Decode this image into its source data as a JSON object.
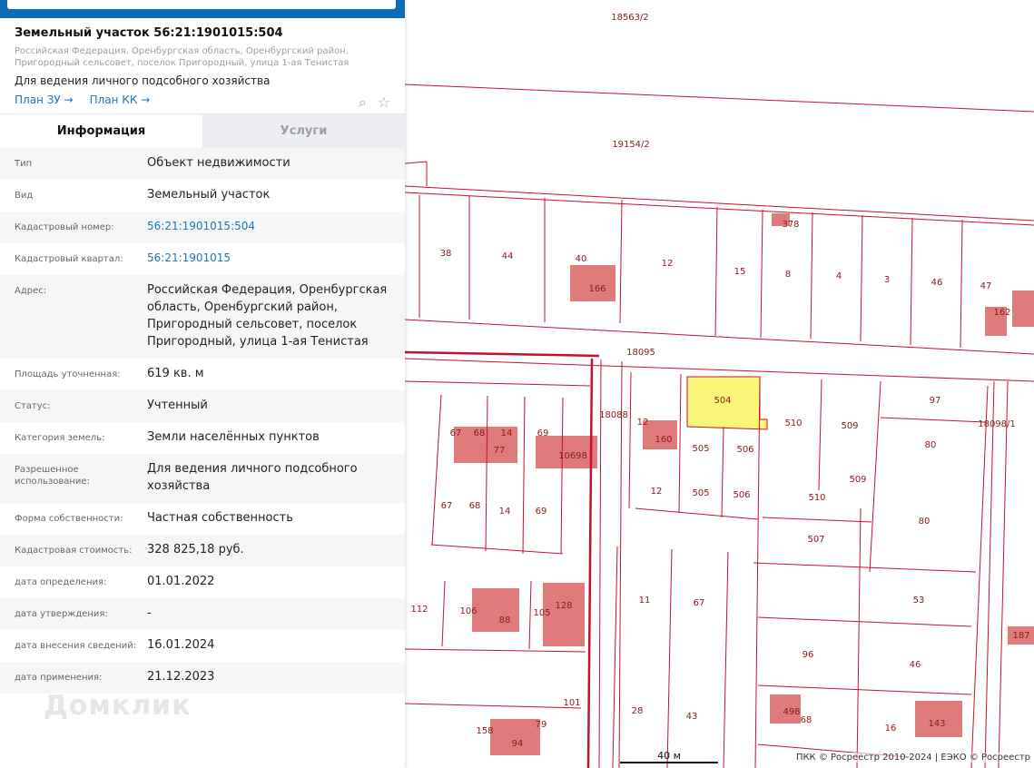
{
  "header": {
    "title": "Земельный участок 56:21:1901015:504",
    "address": "Российская Федерация, Оренбургская область, Оренбургский район, Пригородный сельсовет, поселок Пригородный, улица 1-ая Тенистая",
    "purpose": "Для ведения личного подсобного хозяйства",
    "links": [
      "План ЗУ →",
      "План КК →"
    ],
    "icons": [
      "search-document-icon",
      "star-icon"
    ]
  },
  "tabs": [
    {
      "label": "Информация",
      "active": true
    },
    {
      "label": "Услуги",
      "active": false
    }
  ],
  "rows": [
    {
      "label": "Тип",
      "value": "Объект недвижимости"
    },
    {
      "label": "Вид",
      "value": "Земельный участок"
    },
    {
      "label": "Кадастровый номер:",
      "value": "56:21:1901015:504",
      "link": true
    },
    {
      "label": "Кадастровый квартал:",
      "value": "56:21:1901015",
      "link": true
    },
    {
      "label": "Адрес:",
      "value": "Российская Федерация, Оренбургская область, Оренбургский район, Пригородный сельсовет, поселок Пригородный, улица 1-ая Тенистая"
    },
    {
      "label": "Площадь уточненная:",
      "value": "619 кв. м"
    },
    {
      "label": "Статус:",
      "value": "Учтенный"
    },
    {
      "label": "Категория земель:",
      "value": "Земли населённых пунктов"
    },
    {
      "label": "Разрешенное использование:",
      "value": "Для ведения личного подсобного хозяйства"
    },
    {
      "label": "Форма собственности:",
      "value": "Частная собственность"
    },
    {
      "label": "Кадастровая стоимость:",
      "value": "328 825,18 руб."
    },
    {
      "label": "дата определения:",
      "value": "01.01.2022"
    },
    {
      "label": "дата утверждения:",
      "value": "-"
    },
    {
      "label": "дата внесения сведений:",
      "value": "16.01.2024"
    },
    {
      "label": "дата применения:",
      "value": "21.12.2023"
    }
  ],
  "watermark": "Домклик",
  "map": {
    "scale": "40 м",
    "attribution": "ПКК © Росреестр 2010-2024 | ЕЭКО © Росреестр",
    "colors": {
      "boundary": "#c8102e",
      "building": "#e07b7b",
      "selected": "#fbf57a"
    },
    "labels": [
      "18563/2",
      "19154/2",
      "38",
      "44",
      "40",
      "166",
      "12",
      "378",
      "15",
      "8",
      "4",
      "3",
      "46",
      "47",
      "162",
      "18095",
      "18088",
      "67",
      "68",
      "14",
      "69",
      "77",
      "10698",
      "12",
      "160",
      "504",
      "510",
      "509",
      "97",
      "505",
      "506",
      "80",
      "18098/1",
      "509",
      "505",
      "506",
      "510",
      "12",
      "67",
      "68",
      "14",
      "69",
      "507",
      "80",
      "112",
      "106",
      "88",
      "105",
      "128",
      "11",
      "67",
      "53",
      "96",
      "46",
      "187",
      "28",
      "43",
      "498",
      "68",
      "16",
      "143",
      "158",
      "94",
      "79",
      "101"
    ]
  }
}
